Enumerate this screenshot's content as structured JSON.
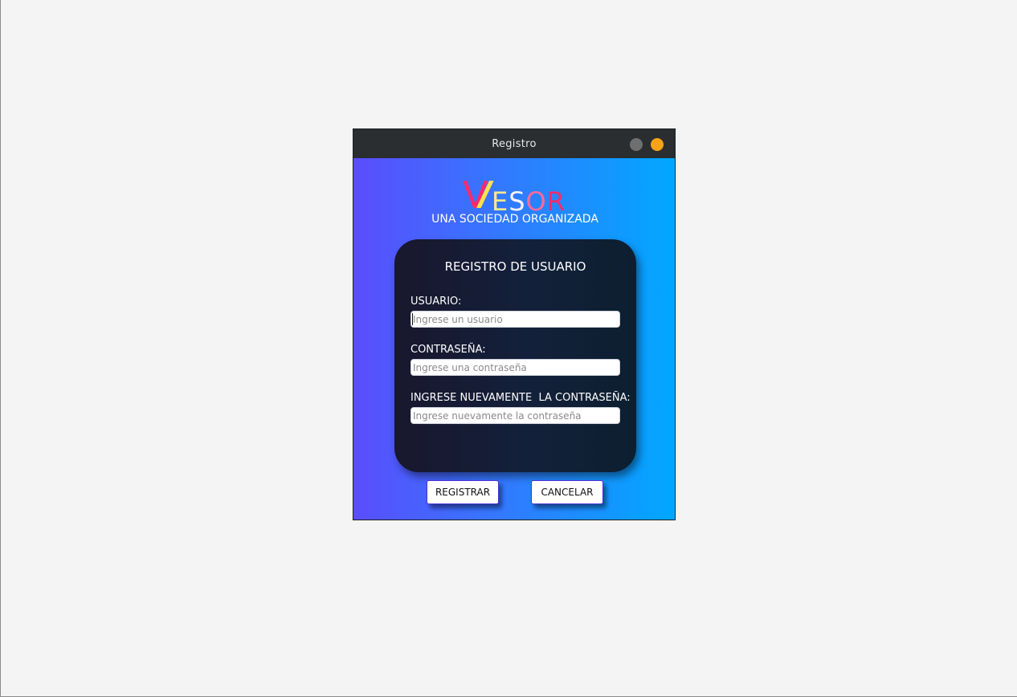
{
  "window": {
    "title": "Registro"
  },
  "brand": {
    "logo_first": "V",
    "logo_rest": [
      "E",
      "S",
      "O",
      "R"
    ],
    "tagline": "UNA SOCIEDAD ORGANIZADA"
  },
  "form": {
    "title": "REGISTRO DE USUARIO",
    "username": {
      "label": "USUARIO:",
      "placeholder": "Ingrese un usuario",
      "value": ""
    },
    "password": {
      "label": "CONTRASEÑA:",
      "placeholder": "Ingrese una contraseña",
      "value": ""
    },
    "confirm": {
      "label": "INGRESE NUEVAMENTE  LA CONTRASEÑA:",
      "placeholder": "Ingrese nuevamente la contraseña",
      "value": ""
    }
  },
  "buttons": {
    "register": "REGISTRAR",
    "cancel": "CANCELAR"
  },
  "colors": {
    "titlebar": "#2b2e30",
    "minimize": "#6f6f6f",
    "close": "#f6a316",
    "gradient_start": "#5a4dfc",
    "gradient_end": "#00a8ff",
    "card": "#13203a",
    "logo_pink": "#ff2a6a",
    "logo_yellow": "#ffe14d"
  }
}
